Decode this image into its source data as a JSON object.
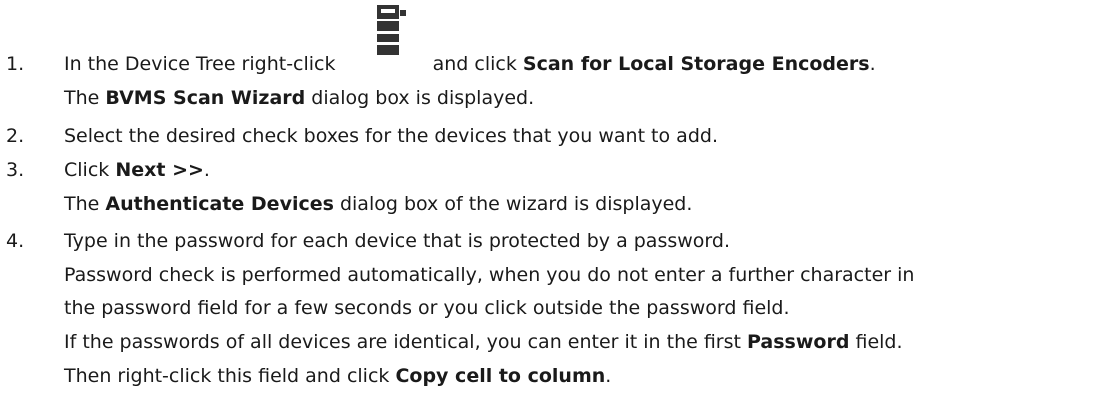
{
  "steps": [
    {
      "number": "1.",
      "prefix": "In the Device Tree right-click",
      "mid": "and click",
      "bold": "Scan for Local Storage Encoders",
      "suffix": ".",
      "result_pre": "The",
      "result_bold": "BVMS Scan Wizard",
      "result_post": "dialog box is displayed."
    },
    {
      "number": "2.",
      "text": "Select the desired check boxes for the devices that you want to add."
    },
    {
      "number": "3.",
      "pre": "Click",
      "bold": "Next >>",
      "suffix": ".",
      "result_pre": "The",
      "result_bold": "Authenticate Devices",
      "result_post": "dialog box of the wizard is displayed."
    },
    {
      "number": "4.",
      "text": "Type in the password for each device that is protected by a password.",
      "detail1": "Password check is performed automatically, when you do not enter a further character in",
      "detail2": "the password field for a few seconds or you click outside the password field.",
      "detail3_pre": "If the passwords of all devices are identical, you can enter it in the first",
      "detail3_bold": "Password",
      "detail3_post": "field.",
      "detail4_pre": "Then right-click this field and click",
      "detail4_bold": "Copy cell to column",
      "detail4_post": "."
    }
  ],
  "icon": {
    "name": "storage-device-icon",
    "color": "#333333"
  }
}
